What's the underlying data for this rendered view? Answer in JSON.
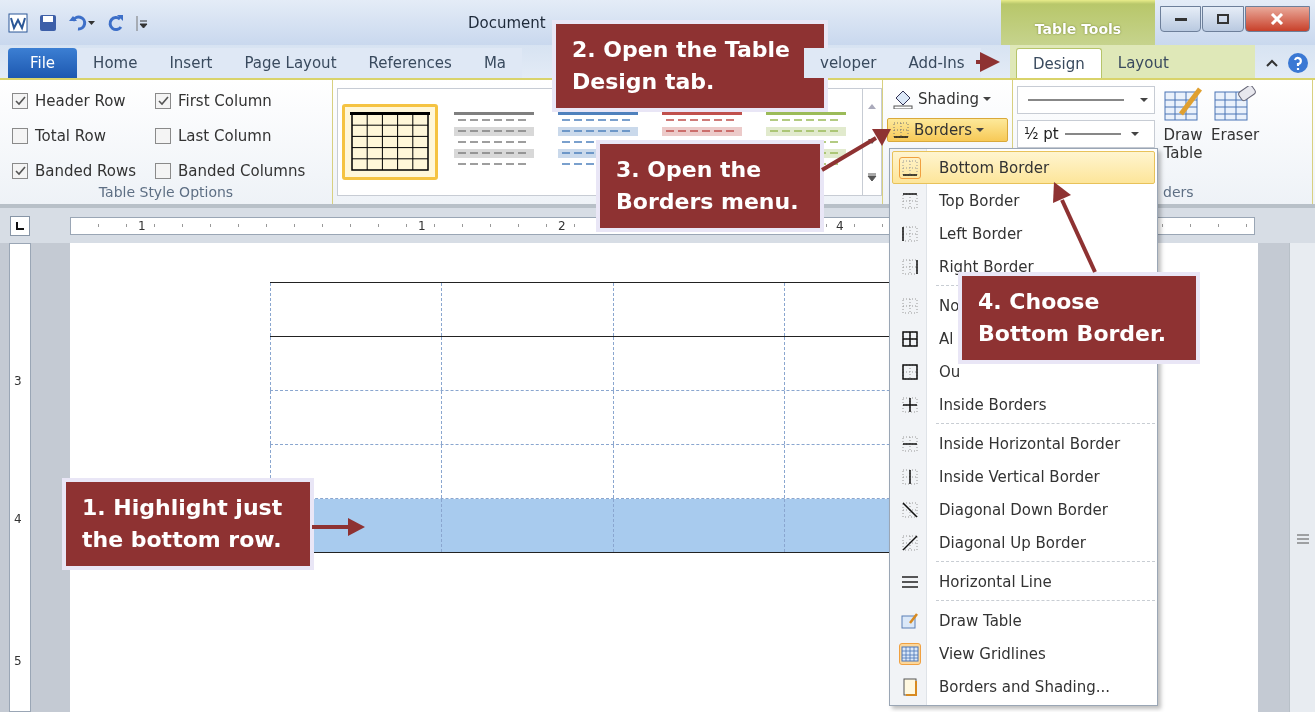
{
  "title_bar": {
    "title": "Document",
    "context_title": "Table Tools"
  },
  "tabs": [
    {
      "label": "File",
      "selected": false,
      "kind": "file"
    },
    {
      "label": "Home",
      "selected": false,
      "kind": "tab"
    },
    {
      "label": "Insert",
      "selected": false,
      "kind": "tab"
    },
    {
      "label": "Page Layout",
      "selected": false,
      "kind": "tab"
    },
    {
      "label": "References",
      "selected": false,
      "kind": "tab"
    },
    {
      "label": "Ma",
      "selected": false,
      "kind": "tab"
    },
    {
      "label": "veloper",
      "selected": false,
      "kind": "cut_start"
    },
    {
      "label": "Add-Ins",
      "selected": false,
      "kind": "tab"
    }
  ],
  "context_tabs": [
    {
      "label": "Design",
      "selected": true
    },
    {
      "label": "Layout",
      "selected": false
    }
  ],
  "style_options": {
    "label": "Table Style Options",
    "options": [
      {
        "label": "Header Row",
        "checked": true
      },
      {
        "label": "First Column",
        "checked": true
      },
      {
        "label": "Total Row",
        "checked": false
      },
      {
        "label": "Last Column",
        "checked": false
      },
      {
        "label": "Banded Rows",
        "checked": true
      },
      {
        "label": "Banded Columns",
        "checked": false
      }
    ]
  },
  "styles": [
    {
      "selected": true,
      "color": "#000000"
    },
    {
      "selected": false,
      "color": "#7f7f7f"
    },
    {
      "selected": false,
      "color": "#4f81bd"
    },
    {
      "selected": false,
      "color": "#c0504d"
    },
    {
      "selected": false,
      "color": "#9bbb59"
    }
  ],
  "shading_button": "Shading",
  "borders_button": "Borders",
  "line_style": {
    "weight": "½ pt"
  },
  "draw_table_button": "Draw Table",
  "eraser_button": "Eraser",
  "draw_group_label": "ders",
  "ruler": {
    "numbers": [
      "1",
      "1",
      "2",
      "4"
    ],
    "vertical_numbers": [
      "3",
      "4",
      "5"
    ]
  },
  "table": {
    "rows": [
      {
        "selected": false,
        "solid_bottom": true
      },
      {
        "selected": false,
        "solid_bottom": false
      },
      {
        "selected": false,
        "solid_bottom": false
      },
      {
        "selected": false,
        "solid_bottom": false
      },
      {
        "selected": true,
        "solid_bottom": true
      }
    ]
  },
  "borders_menu": [
    {
      "kind": "item",
      "label": "Bottom Border",
      "selected": true,
      "checked": false
    },
    {
      "kind": "item",
      "label": "Top Border",
      "selected": false,
      "checked": false
    },
    {
      "kind": "item",
      "label": "Left Border",
      "selected": false,
      "checked": false
    },
    {
      "kind": "item",
      "label": "Right Border",
      "selected": false,
      "checked": false
    },
    {
      "kind": "separator"
    },
    {
      "kind": "item",
      "label": "No",
      "selected": false,
      "checked": false
    },
    {
      "kind": "item",
      "label": "Al",
      "selected": false,
      "checked": false
    },
    {
      "kind": "item",
      "label": "Ou",
      "selected": false,
      "checked": false
    },
    {
      "kind": "item",
      "label": "Inside Borders",
      "selected": false,
      "checked": false
    },
    {
      "kind": "separator"
    },
    {
      "kind": "item",
      "label": "Inside Horizontal Border",
      "selected": false,
      "checked": false
    },
    {
      "kind": "item",
      "label": "Inside Vertical Border",
      "selected": false,
      "checked": false
    },
    {
      "kind": "item",
      "label": "Diagonal Down Border",
      "selected": false,
      "checked": false
    },
    {
      "kind": "item",
      "label": "Diagonal Up Border",
      "selected": false,
      "checked": false
    },
    {
      "kind": "separator"
    },
    {
      "kind": "item",
      "label": "Horizontal Line",
      "selected": false,
      "checked": false
    },
    {
      "kind": "separator"
    },
    {
      "kind": "item",
      "label": "Draw Table",
      "selected": false,
      "checked": false
    },
    {
      "kind": "item",
      "label": "View Gridlines",
      "selected": false,
      "checked": true
    },
    {
      "kind": "item",
      "label": "Borders and Shading...",
      "selected": false,
      "checked": false
    }
  ],
  "callouts": [
    {
      "text": "1. Highlight just the bottom row."
    },
    {
      "text": "2. Open the Table Design tab."
    },
    {
      "text": "3. Open the Borders menu."
    },
    {
      "text": "4. Choose Bottom Border."
    }
  ]
}
